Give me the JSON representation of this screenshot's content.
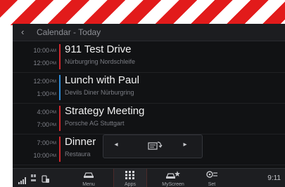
{
  "header": {
    "back_icon": "chevron-left-icon",
    "title": "Calendar - Today"
  },
  "events": [
    {
      "start": "10:00",
      "start_ampm": "AM",
      "end": "12:00",
      "end_ampm": "PM",
      "title": "911 Test Drive",
      "location": "Nürburgring Nordschleife",
      "color": "#d0282e"
    },
    {
      "start": "12:00",
      "start_ampm": "PM",
      "end": "1:00",
      "end_ampm": "PM",
      "title": "Lunch with Paul",
      "location": "Devils Diner Nürburgring",
      "color": "#2e8bd6"
    },
    {
      "start": "4:00",
      "start_ampm": "PM",
      "end": "7:00",
      "end_ampm": "PM",
      "title": "Strategy Meeting",
      "location": "Porsche AG Stuttgart",
      "color": "#d0282e"
    },
    {
      "start": "7:00",
      "start_ampm": "PM",
      "end": "10:00",
      "end_ampm": "PM",
      "title": "Dinner",
      "location": "Restaura",
      "color": "#d0282e"
    }
  ],
  "pager": {
    "prev_icon": "chevron-left-icon",
    "center_icon": "card-swap-icon",
    "next_icon": "chevron-right-icon"
  },
  "taskbar": {
    "status_icons": [
      "signal-icon",
      "network-icon",
      "phone-icon"
    ],
    "tabs": [
      {
        "label": "Menu",
        "icon": "car-icon",
        "active": false
      },
      {
        "label": "Apps",
        "icon": "grid-icon",
        "active": true
      },
      {
        "label": "MyScreen",
        "icon": "car-star-icon",
        "active": false
      },
      {
        "label": "Set",
        "icon": "settings-icon",
        "active": false
      }
    ],
    "clock": "9:11"
  },
  "colors": {
    "accent_red": "#d0282e",
    "accent_blue": "#2e8bd6",
    "background": "#111214"
  }
}
